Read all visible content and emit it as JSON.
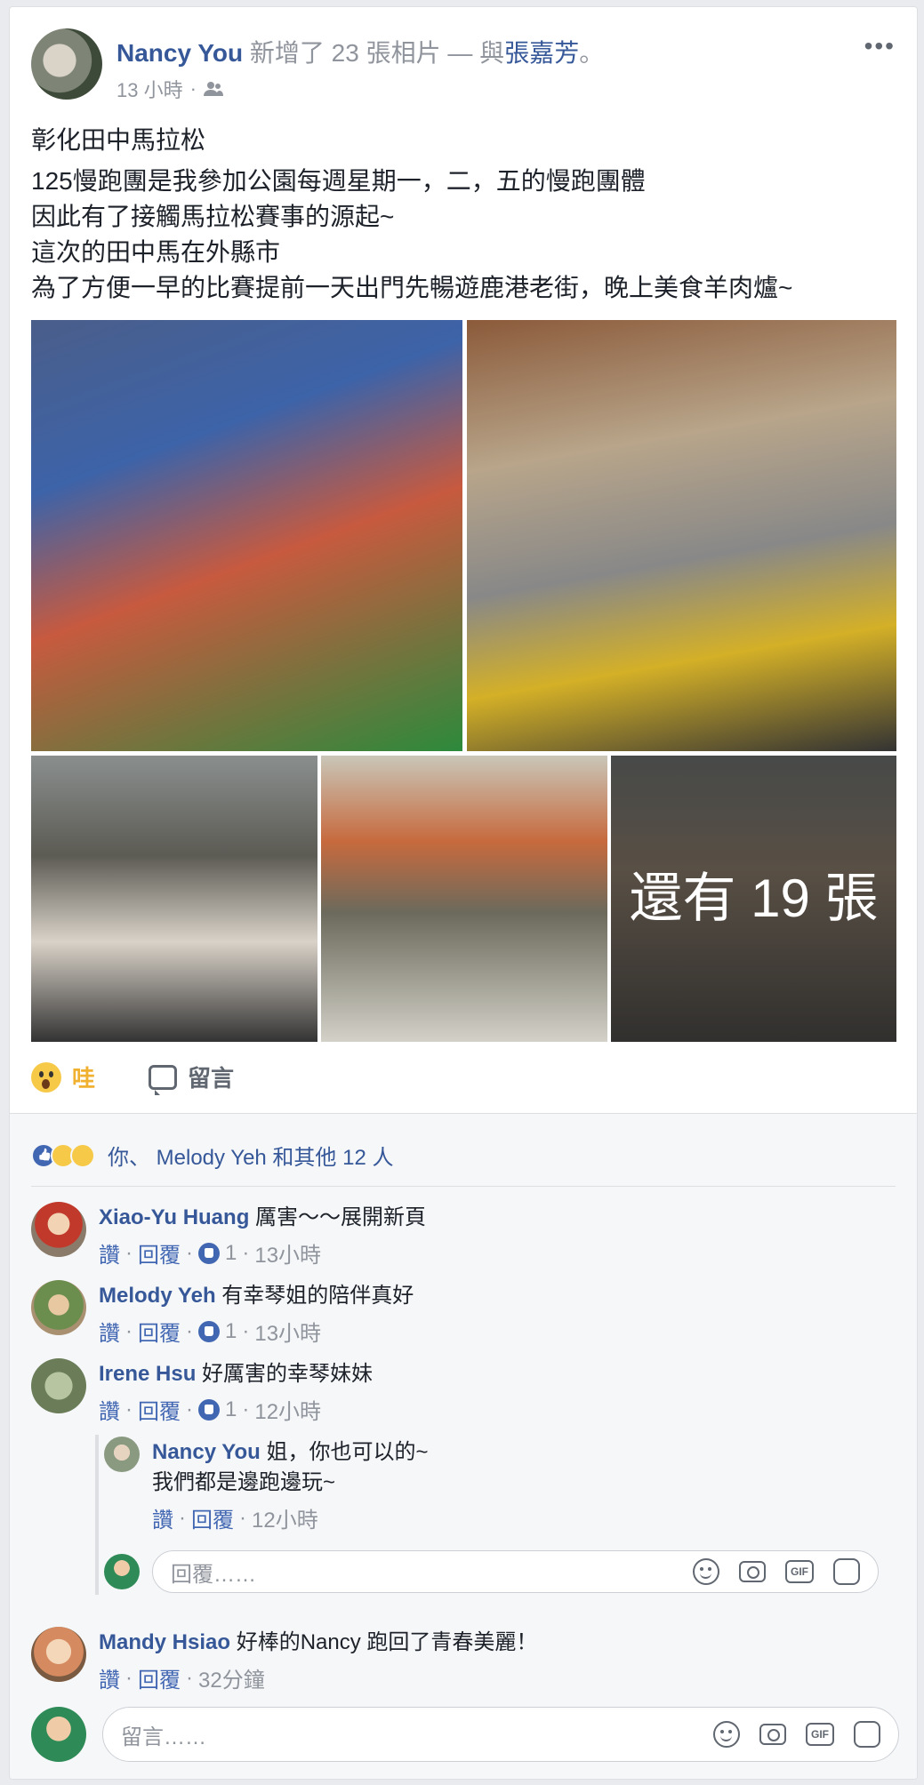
{
  "post": {
    "author": "Nancy You",
    "action": "新增了 23 張相片",
    "with_sep": "— 與",
    "tagged": "張嘉芳",
    "period": "。",
    "time": "13 小時",
    "privacy_icon": "friends-icon",
    "more": "•••",
    "title": "彰化田中馬拉松",
    "body": [
      "125慢跑團是我參加公園每週星期一，二，五的慢跑團體",
      "因此有了接觸馬拉松賽事的源起~",
      "這次的田中馬在外縣市",
      "為了方便一早的比賽提前一天出門先暢遊鹿港老街，晚上美食羊肉爐~"
    ],
    "more_photos": "還有 19 張"
  },
  "actions": {
    "reaction_label": "哇",
    "comment_label": "留言"
  },
  "likes": {
    "text": "你、 Melody Yeh 和其他 12 人"
  },
  "comments": [
    {
      "name": "Xiao-Yu Huang",
      "text": "厲害～～展開新頁",
      "like": "讚",
      "reply": "回覆",
      "count": "1",
      "time": "13小時"
    },
    {
      "name": "Melody Yeh",
      "text": "有幸琴姐的陪伴真好",
      "like": "讚",
      "reply": "回覆",
      "count": "1",
      "time": "13小時"
    },
    {
      "name": "Irene Hsu",
      "text": "好厲害的幸琴妹妹",
      "like": "讚",
      "reply": "回覆",
      "count": "1",
      "time": "12小時"
    },
    {
      "name": "Mandy Hsiao",
      "text": "好棒的Nancy 跑回了青春美麗！",
      "like": "讚",
      "reply": "回覆",
      "time": "32分鐘"
    }
  ],
  "reply": {
    "name": "Nancy You",
    "line1": "姐，你也可以的~",
    "line2": "我們都是邊跑邊玩~",
    "like": "讚",
    "reply": "回覆",
    "time": "12小時"
  },
  "reply_input": {
    "placeholder": "回覆……"
  },
  "comment_input": {
    "placeholder": "留言……"
  },
  "input_icons": [
    "emoji-icon",
    "camera-icon",
    "gif-icon",
    "sticker-icon"
  ],
  "gif_label": "GIF"
}
